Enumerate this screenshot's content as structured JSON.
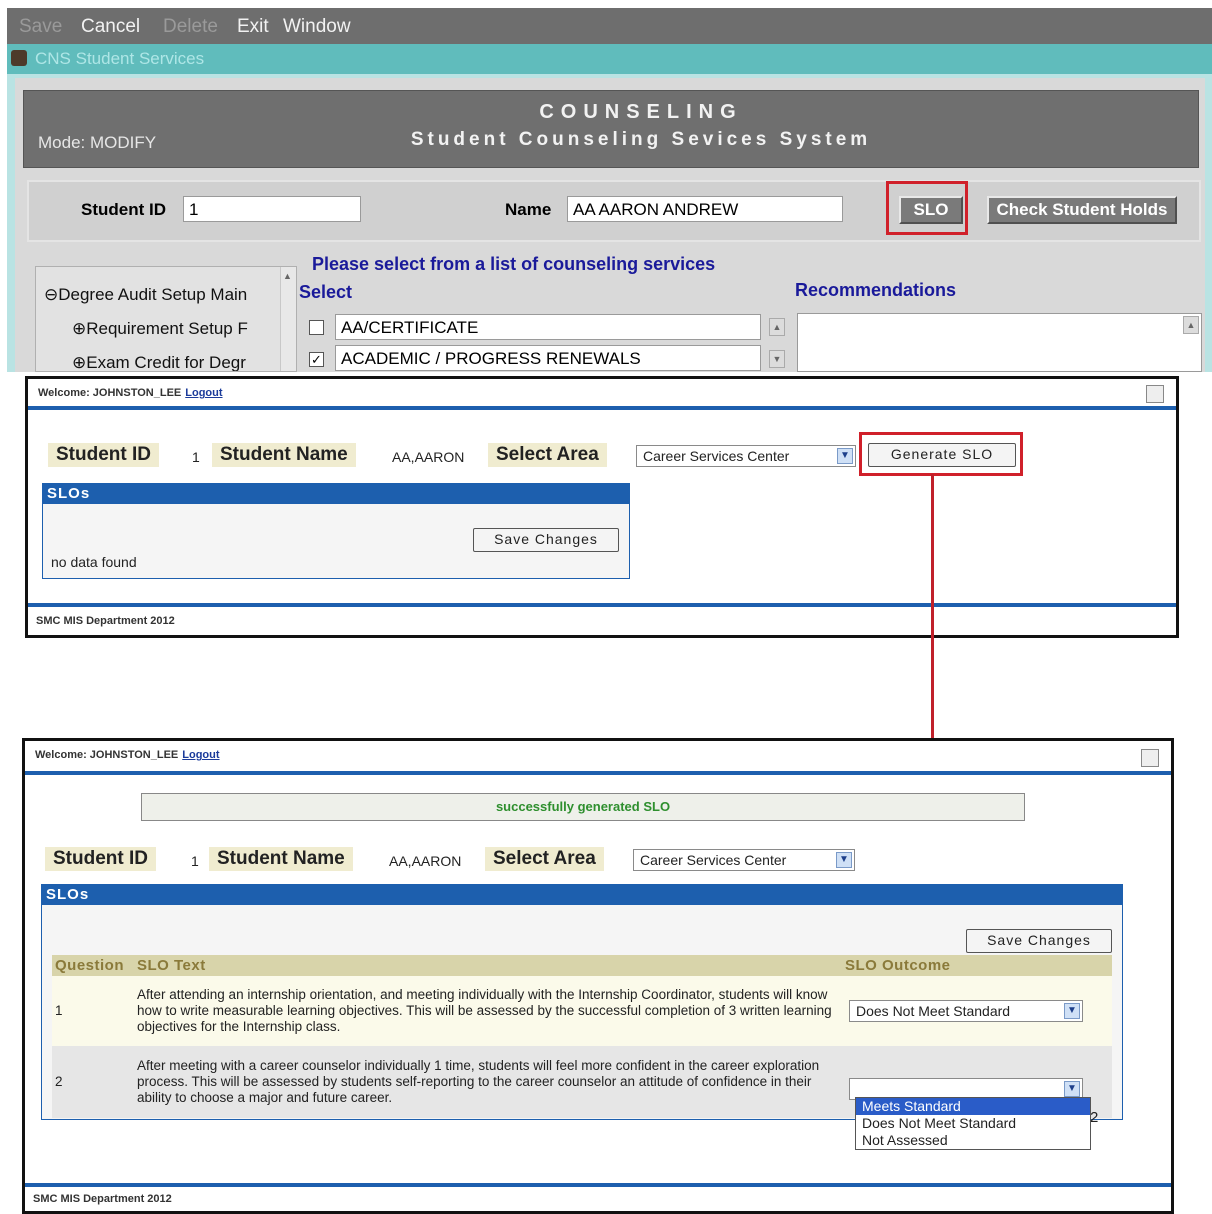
{
  "forms": {
    "menu": [
      {
        "label": "Save",
        "enabled": false
      },
      {
        "label": "Cancel",
        "enabled": true
      },
      {
        "label": "Delete",
        "enabled": false
      },
      {
        "label": "Exit",
        "enabled": true
      },
      {
        "label": "Window",
        "enabled": true
      }
    ],
    "window_title": "CNS Student Services",
    "mode": "Mode: MODIFY",
    "heading": "COUNSELING",
    "subheading": "Student Counseling Sevices System",
    "student_id_label": "Student ID",
    "student_id_value": "1",
    "name_label": "Name",
    "name_value": "AA AARON ANDREW",
    "slo_button": "SLO",
    "holds_button": "Check Student Holds",
    "tree": [
      "Degree Audit Setup Main",
      "Requirement Setup F",
      "Exam Credit for Degr"
    ],
    "services_title": "Please select from a list of counseling services",
    "select_label": "Select",
    "recommendations_label": "Recommendations",
    "services": [
      {
        "label": "AA/CERTIFICATE",
        "checked": false
      },
      {
        "label": "ACADEMIC / PROGRESS RENEWALS",
        "checked": true
      }
    ]
  },
  "web1": {
    "welcome": "Welcome: JOHNSTON_LEE",
    "logout": "Logout",
    "student_id_label": "Student ID",
    "student_id_value": "1",
    "student_name_label": "Student Name",
    "student_name_value": "AA,AARON",
    "select_area_label": "Select Area",
    "select_area_value": "Career Services Center",
    "generate_button": "Generate SLO",
    "slos_title": "SLOs",
    "save_button": "Save Changes",
    "empty_text": "no data found",
    "footer": "SMC MIS Department 2012"
  },
  "web2": {
    "welcome": "Welcome: JOHNSTON_LEE",
    "logout": "Logout",
    "status": "successfully generated SLO",
    "student_id_label": "Student ID",
    "student_id_value": "1",
    "student_name_label": "Student Name",
    "student_name_value": "AA,AARON",
    "select_area_label": "Select Area",
    "select_area_value": "Career Services Center",
    "slos_title": "SLOs",
    "save_button": "Save Changes",
    "columns": [
      "Question",
      "SLO Text",
      "SLO Outcome"
    ],
    "rows": [
      {
        "question": "1",
        "text": "After attending an internship orientation, and meeting individually with the Internship Coordinator, students will know how to write measurable learning objectives. This will be assessed by the successful completion of 3 written learning objectives for the Internship class.",
        "outcome": "Does Not Meet Standard"
      },
      {
        "question": "2",
        "text": "After meeting with a career counselor individually 1 time, students will feel more confident in the career exploration process. This will be assessed by students self-reporting to the career counselor an attitude of confidence in their ability to choose a major and future career.",
        "outcome": ""
      }
    ],
    "dropdown_options": [
      "Meets Standard",
      "Does Not Meet Standard",
      "Not Assessed"
    ],
    "pager_text": "2",
    "footer": "SMC MIS Department 2012"
  }
}
